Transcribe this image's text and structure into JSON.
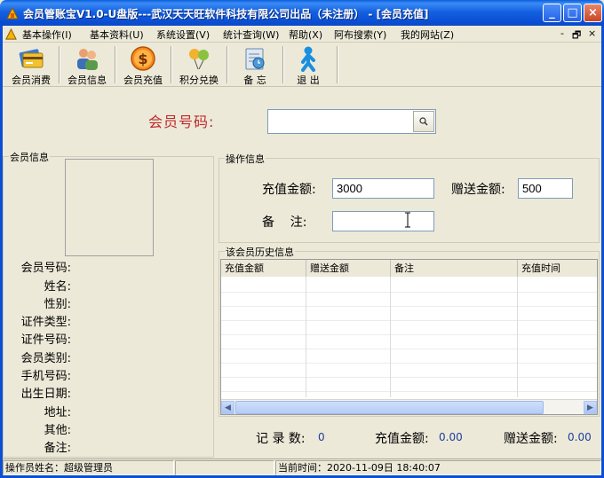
{
  "window": {
    "title": "会员管账宝V1.0-U盘版---武汉天天旺软件科技有限公司出品（未注册）  - [会员充值]",
    "minimize": "_",
    "maximize": "□",
    "close": "×"
  },
  "menu": {
    "items": [
      "基本操作(I)",
      "基本资料(U)",
      "系统设置(V)",
      "统计查询(W)",
      "帮助(X)",
      "阿布搜索(Y)",
      "我的网站(Z)"
    ],
    "mdi_min": "-",
    "mdi_restore": "🗗",
    "mdi_close": "×"
  },
  "toolbar": {
    "buttons": [
      {
        "label": "会员消费",
        "icon": "wallet-icon"
      },
      {
        "label": "会员信息",
        "icon": "users-icon"
      },
      {
        "label": "会员充值",
        "icon": "dollar-coin-icon"
      },
      {
        "label": "积分兑换",
        "icon": "balloons-icon"
      },
      {
        "label": "备 忘",
        "icon": "memo-icon"
      },
      {
        "label": "退 出",
        "icon": "exit-person-icon"
      }
    ]
  },
  "search": {
    "label": "会员号码:",
    "value": ""
  },
  "member_info": {
    "title": "会员信息",
    "fields": [
      "会员号码:",
      "姓名:",
      "性别:",
      "证件类型:",
      "证件号码:",
      "会员类别:",
      "手机号码:",
      "出生日期:",
      "地址:",
      "其他:",
      "备注:"
    ]
  },
  "operation": {
    "title": "操作信息",
    "recharge_label": "充值金额:",
    "recharge_value": "3000",
    "bonus_label": "赠送金额:",
    "bonus_value": "500",
    "remark_label": "备    注:",
    "remark_value": ""
  },
  "history": {
    "title": "该会员历史信息",
    "columns": [
      "充值金额",
      "赠送金额",
      "备注",
      "充值时间"
    ]
  },
  "summary": {
    "count_label": "记 录 数:",
    "count_value": "0",
    "recharge_label": "充值金额:",
    "recharge_value": "0.00",
    "bonus_label": "赠送金额:",
    "bonus_value": "0.00"
  },
  "status": {
    "operator": "操作员姓名：超级管理员",
    "time": "当前时间：2020-11-09日  18:40:07"
  },
  "colors": {
    "accent_red": "#c0282d",
    "value_blue": "#1f3f9a",
    "title_blue": "#0b4fd4"
  }
}
